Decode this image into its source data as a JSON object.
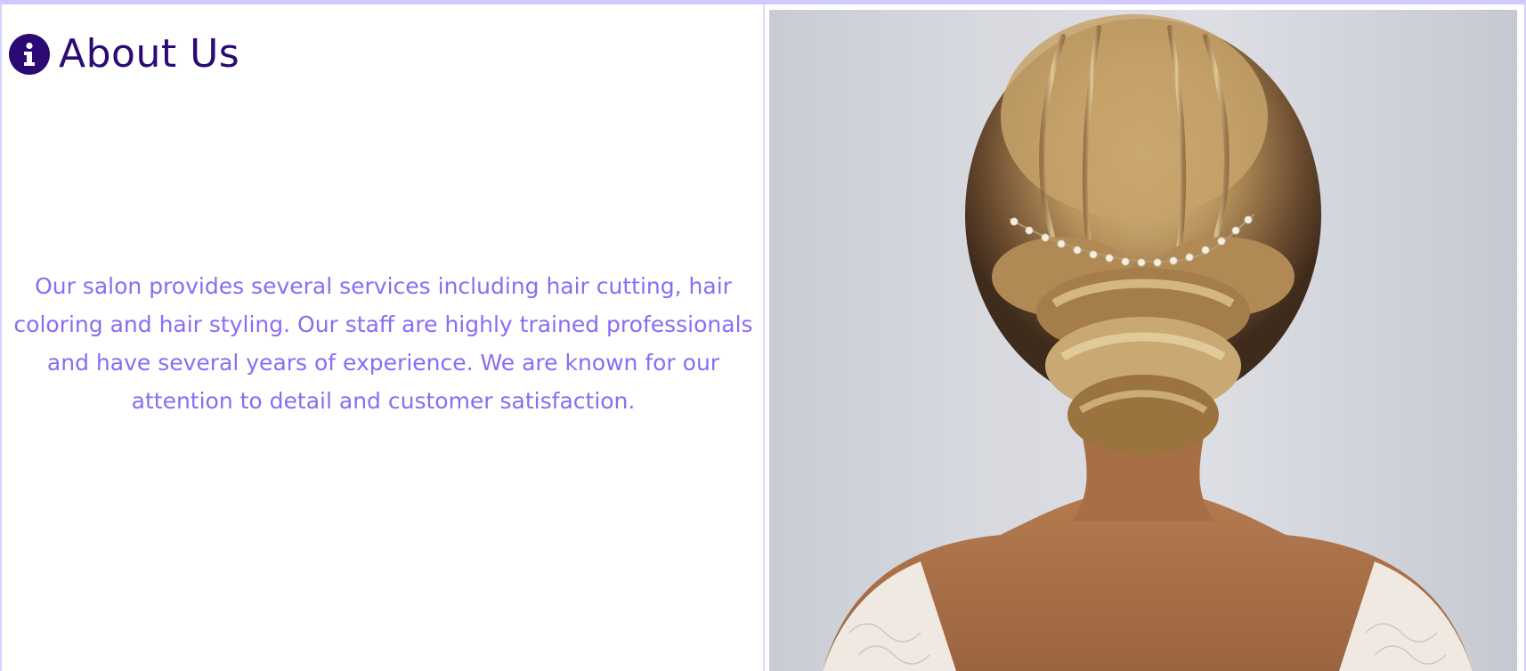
{
  "about": {
    "title": "About Us",
    "body": "Our salon provides several services including hair cutting, hair coloring and hair styling. Our staff are highly trained professionals and have several years of experience. We are known for our attention to detail and customer satisfaction."
  },
  "icons": {
    "heading_icon": "info-circle-icon"
  },
  "image": {
    "subject": "bridal-updo-hairstyle-photo"
  },
  "colors": {
    "heading": "#2b0a74",
    "body_text": "#8a6cf5",
    "frame_border": "#cfc9ff"
  }
}
